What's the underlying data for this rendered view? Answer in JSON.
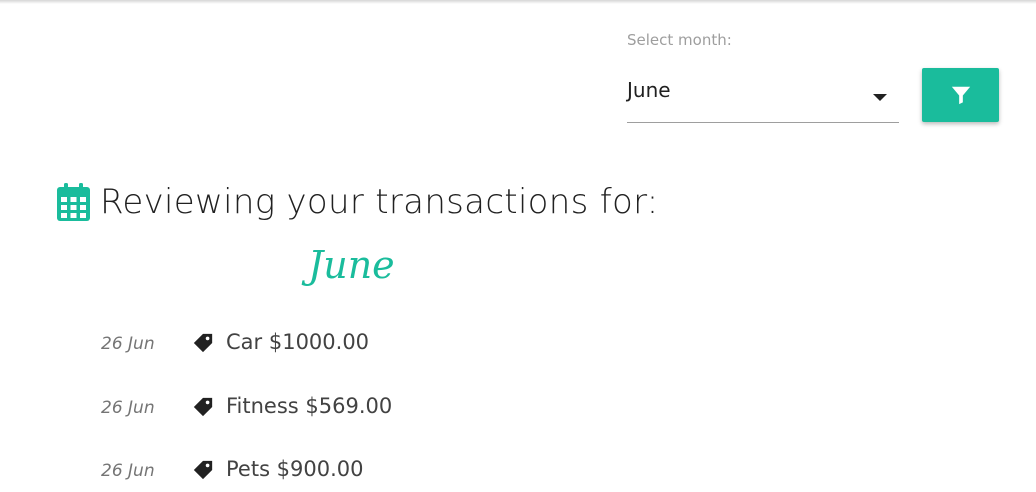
{
  "filter": {
    "label": "Select month:",
    "selected_month": "June",
    "button_icon": "filter-icon",
    "accent_color": "#1abc9c"
  },
  "heading": {
    "icon": "calendar-icon",
    "title": "Reviewing your transactions for:",
    "month": "June"
  },
  "transactions": [
    {
      "date": "26 Jun",
      "icon": "tag-icon",
      "label": "Car $1000.00"
    },
    {
      "date": "26 Jun",
      "icon": "tag-icon",
      "label": "Fitness $569.00"
    },
    {
      "date": "26 Jun",
      "icon": "tag-icon",
      "label": "Pets $900.00"
    }
  ]
}
